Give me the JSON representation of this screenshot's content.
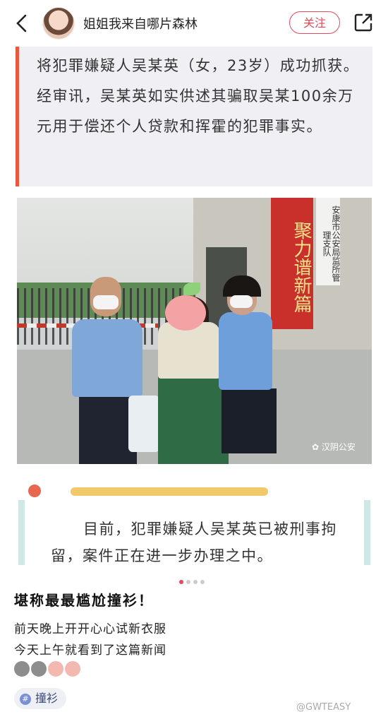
{
  "header": {
    "username": "姐姐我来自哪片森林",
    "follow_label": "关注"
  },
  "article": {
    "top_text": "将犯罪嫌疑人吴某英（女，23岁）成功抓获。经审讯，吴某英如实供述其骗取吴某100余万元用于偿还个人贷款和挥霍的犯罪事实。",
    "photo": {
      "banner_red": "聚力谱新篇",
      "banner_white": "安康市公安局监所管理支队",
      "watermark": "汉阴公安"
    },
    "bottom_text": "目前，犯罪嫌疑人吴某英已被刑事拘留，案件正在进一步办理之中。"
  },
  "carousel": {
    "count": 4,
    "active_index": 0
  },
  "post": {
    "title": "堪称最最尴尬撞衫！",
    "lines": [
      "前天晚上开开心心试新衣服",
      "今天上午就看到了这篇新闻"
    ],
    "emojis": [
      "grey-face-emoji",
      "grey-face-emoji",
      "crying-face-emoji",
      "crying-face-emoji"
    ]
  },
  "tag": {
    "label": "撞衫"
  },
  "watermark_corner": "@GWTEASY",
  "colors": {
    "accent": "#e8485a",
    "bar": "#e9573f",
    "yellow": "#f0c96b"
  }
}
